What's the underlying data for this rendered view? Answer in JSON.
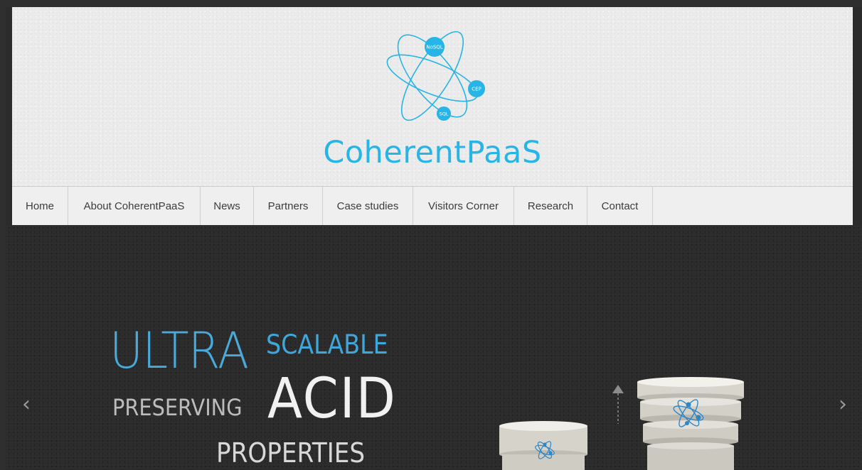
{
  "brand": {
    "name": "CoherentPaaS"
  },
  "logo": {
    "nodes": [
      "NoSQL",
      "CEP",
      "SQL"
    ],
    "color": "#27b4e6"
  },
  "nav": {
    "items": [
      {
        "label": "Home"
      },
      {
        "label": "About CoherentPaaS"
      },
      {
        "label": "News"
      },
      {
        "label": "Partners"
      },
      {
        "label": "Case studies"
      },
      {
        "label": "Visitors Corner"
      },
      {
        "label": "Research"
      },
      {
        "label": "Contact"
      }
    ]
  },
  "hero": {
    "word_ultra": "ULTRA",
    "word_scalable": "SCALABLE",
    "word_preserving": "PRESERVING",
    "word_acid": "ACID",
    "word_properties": "PROPERTIES",
    "prev_icon": "chevron-left-icon",
    "next_icon": "chevron-right-icon",
    "prev_glyph": "‹",
    "next_glyph": "›"
  },
  "colors": {
    "accent": "#27b4e6",
    "hero_background": "#2b2b2b",
    "header_background": "#ebebeb"
  }
}
